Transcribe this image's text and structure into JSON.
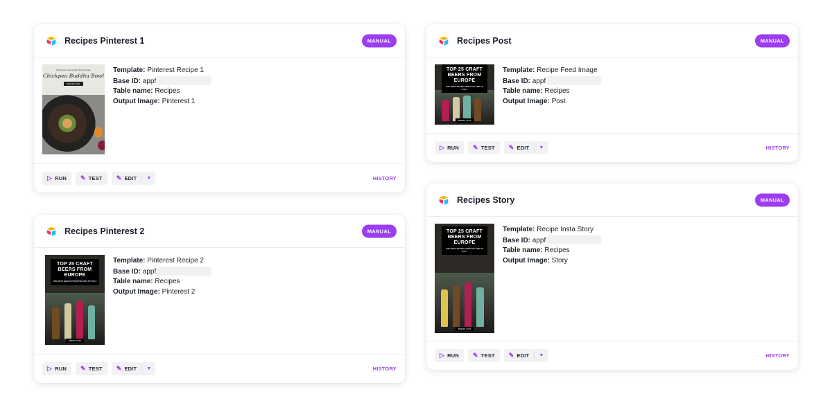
{
  "colors": {
    "accent": "#9b3df0",
    "button_bg": "#f2f2f5"
  },
  "cards": [
    {
      "title": "Recipes Pinterest 1",
      "badge": "MANUAL",
      "thumbnail": {
        "kind": "bowl",
        "top_text": "Filling Easy and Healthy Bowl Recipe",
        "title": "Chickpea Buddha Bowl",
        "tag": "RECIPE.COM"
      },
      "fields": [
        {
          "label": "Template:",
          "value": "Pinterest Recipe 1"
        },
        {
          "label": "Base ID:",
          "value": "appf"
        },
        {
          "label": "Table name:",
          "value": "Recipes"
        },
        {
          "label": "Output Image:",
          "value": "Pinterest 1"
        }
      ],
      "actions": {
        "run": "RUN",
        "test": "TEST",
        "edit": "EDIT",
        "history": "HISTORY"
      }
    },
    {
      "title": "Recipes Pinterest 2",
      "badge": "MANUAL",
      "thumbnail": {
        "kind": "beer",
        "title": "TOP 25 CRAFT BEERS FROM EUROPE",
        "subtitle": "THE BEST BEERS FROM POLAND TO ITALY",
        "tag": "BEERS.COM"
      },
      "fields": [
        {
          "label": "Template:",
          "value": "Pinterest Recipe 2"
        },
        {
          "label": "Base ID:",
          "value": "appf"
        },
        {
          "label": "Table name:",
          "value": "Recipes"
        },
        {
          "label": "Output Image:",
          "value": "Pinterest 2"
        }
      ],
      "actions": {
        "run": "RUN",
        "test": "TEST",
        "edit": "EDIT",
        "history": "HISTORY"
      }
    },
    {
      "title": "Recipes Post",
      "badge": "MANUAL",
      "thumbnail": {
        "kind": "beer",
        "title": "TOP 25 CRAFT BEERS FROM EUROPE",
        "subtitle": "THE BEST BEERS FROM POLAND TO ITALY",
        "tag": "BEERS.COM"
      },
      "fields": [
        {
          "label": "Template:",
          "value": "Recipe Feed Image"
        },
        {
          "label": "Base ID:",
          "value": "appf"
        },
        {
          "label": "Table name:",
          "value": "Recipes"
        },
        {
          "label": "Output Image:",
          "value": "Post"
        }
      ],
      "actions": {
        "run": "RUN",
        "test": "TEST",
        "edit": "EDIT",
        "history": "HISTORY"
      }
    },
    {
      "title": "Recipes Story",
      "badge": "MANUAL",
      "thumbnail": {
        "kind": "beer",
        "title": "TOP 25 CRAFT BEERS FROM EUROPE",
        "subtitle": "THE BEST BEERS FROM POLAND TO ITALY",
        "tag": "BEERS.COM"
      },
      "fields": [
        {
          "label": "Template:",
          "value": "Recipe Insta Story"
        },
        {
          "label": "Base ID:",
          "value": "appf"
        },
        {
          "label": "Table name:",
          "value": "Recipes"
        },
        {
          "label": "Output Image:",
          "value": "Story"
        }
      ],
      "actions": {
        "run": "RUN",
        "test": "TEST",
        "edit": "EDIT",
        "history": "HISTORY"
      }
    }
  ]
}
